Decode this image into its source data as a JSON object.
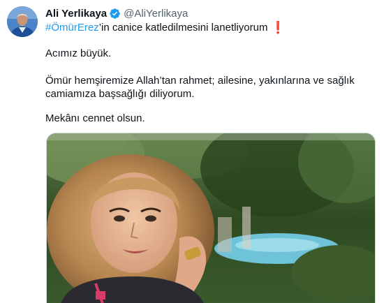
{
  "tweet": {
    "author": {
      "display_name": "Ali Yerlikaya",
      "handle": "@AliYerlikaya",
      "verified": true
    },
    "hashtag": "#ÖmürErez",
    "line1_rest": "’in canice katledilmesini lanetliyorum",
    "emoji": "❗",
    "paragraph1": "Acımız büyük.",
    "paragraph2_line1": "Ömür hemşiremize Allah’tan rahmet; ailesine, yakınlarına ve sağlık",
    "paragraph2_line2": "camiamıza başsağlığı diliyorum.",
    "paragraph3": "Mekânı cennet olsun."
  },
  "colors": {
    "link": "#1d9bf0",
    "text": "#0f1419",
    "secondary": "#536471",
    "verified": "#1d9bf0",
    "emoji_red": "#dd2e44"
  },
  "icons": {
    "verified": "verified-badge-icon"
  }
}
